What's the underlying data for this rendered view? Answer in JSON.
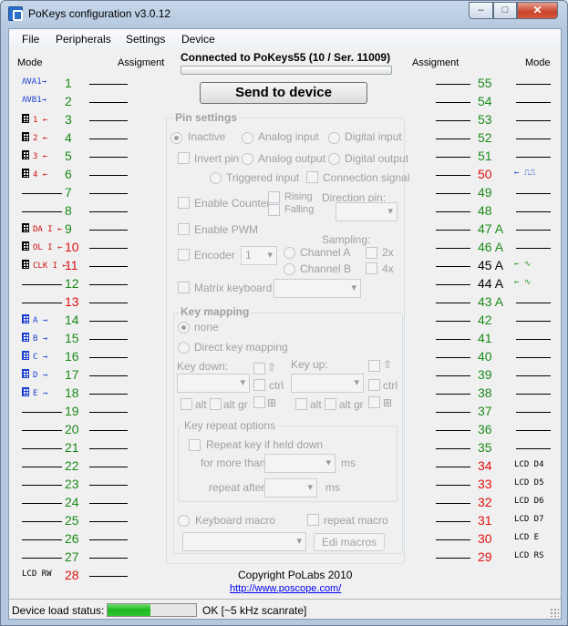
{
  "window": {
    "title": "PoKeys configuration v3.0.12",
    "min": "–",
    "max": "□",
    "close": "✕"
  },
  "menu": [
    "File",
    "Peripherals",
    "Settings",
    "Device"
  ],
  "headers": {
    "mode_left": "Mode",
    "assign_left": "Assigment",
    "assign_right": "Assigment",
    "mode_right": "Mode"
  },
  "connection": "Connected to PoKeys55 (10 / Ser. 11009)",
  "send_button": "Send to device",
  "left_pins": [
    {
      "num": "1",
      "color": "green",
      "tag": "ꟿA1→",
      "tagcolor": "blue"
    },
    {
      "num": "2",
      "color": "green",
      "tag": "ꟿB1→",
      "tagcolor": "blue"
    },
    {
      "num": "3",
      "color": "green",
      "tag": "1 ←",
      "tagcolor": "red",
      "grid": "k"
    },
    {
      "num": "4",
      "color": "green",
      "tag": "2 ←",
      "tagcolor": "red",
      "grid": "k"
    },
    {
      "num": "5",
      "color": "green",
      "tag": "3 ←",
      "tagcolor": "red",
      "grid": "k"
    },
    {
      "num": "6",
      "color": "green",
      "tag": "4 ←",
      "tagcolor": "red",
      "grid": "k"
    },
    {
      "num": "7",
      "color": "green",
      "tag": ""
    },
    {
      "num": "8",
      "color": "green",
      "tag": ""
    },
    {
      "num": "9",
      "color": "green",
      "tag": "DA I ←",
      "tagcolor": "red",
      "grid": "k"
    },
    {
      "num": "10",
      "color": "red",
      "tag": "OL I ←",
      "tagcolor": "red",
      "grid": "k"
    },
    {
      "num": "11",
      "color": "red",
      "tag": "CLK I ←",
      "tagcolor": "red",
      "grid": "k"
    },
    {
      "num": "12",
      "color": "green",
      "tag": ""
    },
    {
      "num": "13",
      "color": "red",
      "tag": ""
    },
    {
      "num": "14",
      "color": "green",
      "tag": "A →",
      "tagcolor": "blue",
      "grid": "b"
    },
    {
      "num": "15",
      "color": "green",
      "tag": "B →",
      "tagcolor": "blue",
      "grid": "b"
    },
    {
      "num": "16",
      "color": "green",
      "tag": "C →",
      "tagcolor": "blue",
      "grid": "b"
    },
    {
      "num": "17",
      "color": "green",
      "tag": "D →",
      "tagcolor": "blue",
      "grid": "b"
    },
    {
      "num": "18",
      "color": "green",
      "tag": "E →",
      "tagcolor": "blue",
      "grid": "b"
    },
    {
      "num": "19",
      "color": "green",
      "tag": ""
    },
    {
      "num": "20",
      "color": "green",
      "tag": ""
    },
    {
      "num": "21",
      "color": "green",
      "tag": ""
    },
    {
      "num": "22",
      "color": "green",
      "tag": ""
    },
    {
      "num": "23",
      "color": "green",
      "tag": ""
    },
    {
      "num": "24",
      "color": "green",
      "tag": ""
    },
    {
      "num": "25",
      "color": "green",
      "tag": ""
    },
    {
      "num": "26",
      "color": "green",
      "tag": ""
    },
    {
      "num": "27",
      "color": "green",
      "tag": ""
    },
    {
      "num": "28",
      "color": "red",
      "tag": "LCD RW",
      "tagcolor": "blk"
    }
  ],
  "right_pins": [
    {
      "num": "55",
      "color": "green",
      "tag": ""
    },
    {
      "num": "54",
      "color": "green",
      "tag": ""
    },
    {
      "num": "53",
      "color": "green",
      "tag": ""
    },
    {
      "num": "52",
      "color": "green",
      "tag": ""
    },
    {
      "num": "51",
      "color": "green",
      "tag": ""
    },
    {
      "num": "50",
      "color": "red",
      "tag": "← ⎍⎍",
      "tagcolor": "blue"
    },
    {
      "num": "49",
      "color": "green",
      "tag": ""
    },
    {
      "num": "48",
      "color": "green",
      "tag": ""
    },
    {
      "num": "47 A",
      "color": "green",
      "tag": ""
    },
    {
      "num": "46 A",
      "color": "green",
      "tag": ""
    },
    {
      "num": "45 A",
      "color": "black",
      "tag": "← ∿",
      "tagcolor": "green"
    },
    {
      "num": "44 A",
      "color": "black",
      "tag": "← ∿",
      "tagcolor": "green"
    },
    {
      "num": "43 A",
      "color": "green",
      "tag": ""
    },
    {
      "num": "42",
      "color": "green",
      "tag": ""
    },
    {
      "num": "41",
      "color": "green",
      "tag": ""
    },
    {
      "num": "40",
      "color": "green",
      "tag": ""
    },
    {
      "num": "39",
      "color": "green",
      "tag": ""
    },
    {
      "num": "38",
      "color": "green",
      "tag": ""
    },
    {
      "num": "37",
      "color": "green",
      "tag": ""
    },
    {
      "num": "36",
      "color": "green",
      "tag": ""
    },
    {
      "num": "35",
      "color": "green",
      "tag": ""
    },
    {
      "num": "34",
      "color": "red",
      "tag": "LCD D4",
      "tagcolor": "blk"
    },
    {
      "num": "33",
      "color": "red",
      "tag": "LCD D5",
      "tagcolor": "blk"
    },
    {
      "num": "32",
      "color": "red",
      "tag": "LCD D6",
      "tagcolor": "blk"
    },
    {
      "num": "31",
      "color": "red",
      "tag": "LCD D7",
      "tagcolor": "blk"
    },
    {
      "num": "30",
      "color": "red",
      "tag": "LCD E",
      "tagcolor": "blk"
    },
    {
      "num": "29",
      "color": "red",
      "tag": "LCD RS",
      "tagcolor": "blk"
    }
  ],
  "pin_settings": {
    "title": "Pin settings",
    "inactive": "Inactive",
    "analog_input": "Analog input",
    "digital_input": "Digital input",
    "invert_pin": "Invert pin",
    "analog_output": "Analog output",
    "digital_output": "Digital output",
    "triggered_input": "Triggered input",
    "connection_signal": "Connection signal",
    "enable_counter": "Enable Counter",
    "rising": "Rising",
    "falling": "Falling",
    "direction_pin": "Direction pin:",
    "enable_pwm": "Enable PWM",
    "encoder": "Encoder",
    "encoder_value": "1",
    "channel_a": "Channel A",
    "channel_b": "Channel B",
    "sampling": "Sampling:",
    "s2x": "2x",
    "s4x": "4x",
    "matrix_keyboard": "Matrix keyboard"
  },
  "key_mapping": {
    "title": "Key mapping",
    "none": "none",
    "direct": "Direct key mapping",
    "key_down": "Key down:",
    "key_up": "Key up:",
    "ctrl": "ctrl",
    "alt": "alt",
    "altgr": "alt gr",
    "repeat_title": "Key repeat options",
    "repeat_held": "Repeat key if held down",
    "more_than": "for more than",
    "ms": "ms",
    "repeat_after": "repeat after",
    "keyboard_macro": "Keyboard macro",
    "repeat_macro": "repeat macro",
    "edit_macros": "Edi macros"
  },
  "footer": {
    "copyright": "Copyright PoLabs 2010",
    "url": "http://www.poscope.com/"
  },
  "status": {
    "label": "Device load status:",
    "text": "OK [~5 kHz scanrate]",
    "progress": 0.48
  }
}
